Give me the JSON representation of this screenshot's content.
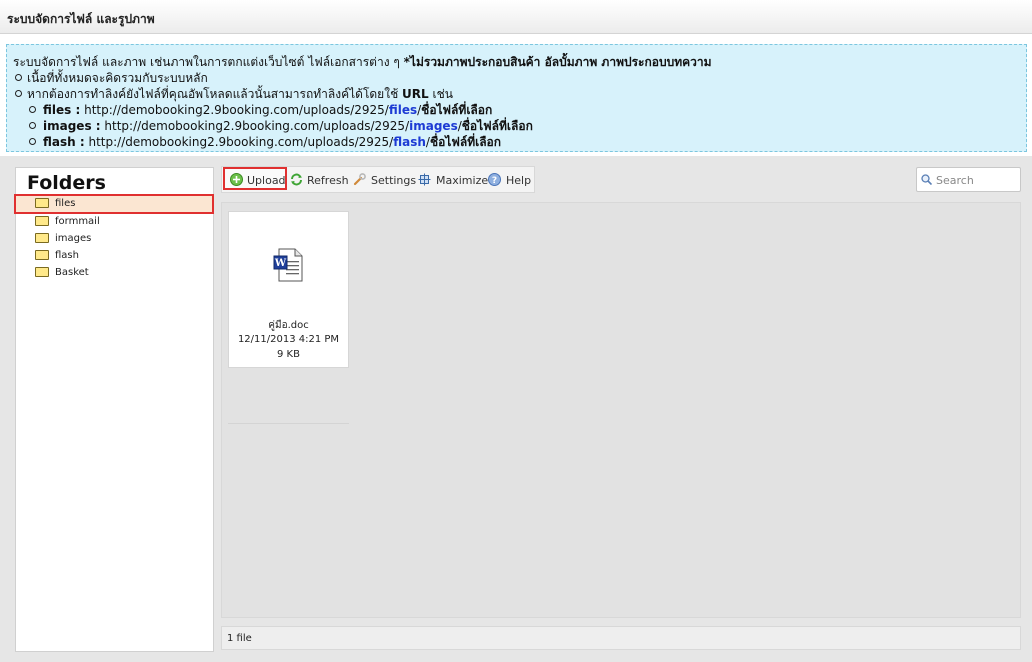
{
  "header": {
    "title": "ระบบจัดการไฟล์ และรูปภาพ"
  },
  "info": {
    "line1_normal": "ระบบจัดการไฟล์ และภาพ เช่นภาพในการตกแต่งเว็บไซต์ ไฟล์เอกสารต่าง ๆ ",
    "line1_bold": "*ไม่รวมภาพประกอบสินค้า อัลบั้มภาพ ภาพประกอบบทความ",
    "bullet1": "เนื้อที่ทั้งหมดจะคิดรวมกับระบบหลัก",
    "bullet2_normal": "หากต้องการทำลิงค์ยังไฟล์ที่คุณอัพโหลดแล้วนั้นสามารถทำลิงค์ได้โดยใช้ ",
    "bullet2_bold": "URL",
    "bullet2_tail": " เช่น",
    "url_prefix": "http://demobooking2.9booking.com/uploads/2925/",
    "url_suffix": "ชื่อไฟล์ที่เลือก",
    "examples": [
      {
        "label": "files :",
        "folder": "files"
      },
      {
        "label": "images :",
        "folder": "images"
      },
      {
        "label": "flash :",
        "folder": "flash"
      }
    ]
  },
  "folders": {
    "title": "Folders",
    "items": [
      {
        "label": "files",
        "selected": true
      },
      {
        "label": "formmail",
        "selected": false
      },
      {
        "label": "images",
        "selected": false
      },
      {
        "label": "flash",
        "selected": false
      },
      {
        "label": "Basket",
        "selected": false
      }
    ]
  },
  "toolbar": {
    "upload": "Upload",
    "refresh": "Refresh",
    "settings": "Settings",
    "maximize": "Maximize",
    "help": "Help",
    "search_placeholder": "Search"
  },
  "files": [
    {
      "name": "คู่มือ.doc",
      "date": "12/11/2013 4:21 PM",
      "size": "9 KB",
      "icon": "word-doc-icon"
    }
  ],
  "status": {
    "text": "1 file"
  },
  "colors": {
    "accent_blue": "#1d3bd4",
    "highlight_red": "#e03030",
    "info_bg": "#d7f2fb"
  }
}
